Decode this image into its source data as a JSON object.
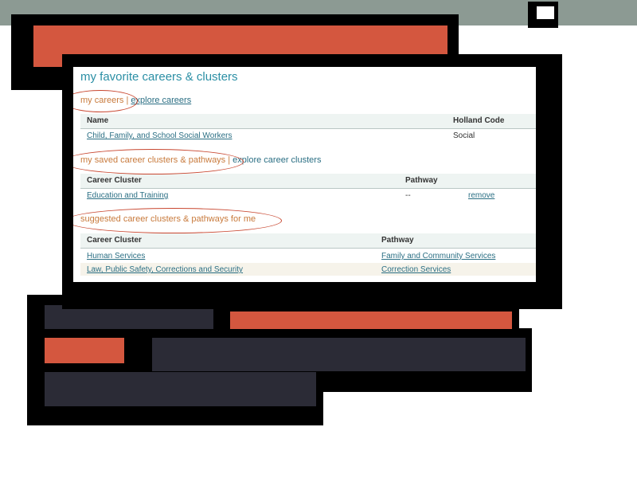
{
  "page": {
    "title": "my favorite careers & clusters"
  },
  "my_careers": {
    "heading": "my careers",
    "separator": "|",
    "explore_link": "explore careers",
    "columns": [
      "Name",
      "Holland Code"
    ],
    "rows": [
      {
        "name": "Child, Family, and School Social Workers",
        "holland_code": "Social"
      }
    ]
  },
  "saved_clusters": {
    "heading": "my saved career clusters & pathways",
    "separator": "|",
    "explore_link": "explore career clusters",
    "columns": [
      "Career Cluster",
      "Pathway"
    ],
    "rows": [
      {
        "cluster": "Education and Training",
        "pathway": "--",
        "action": "remove"
      }
    ]
  },
  "suggested_clusters": {
    "heading": "suggested career clusters & pathways for me",
    "columns": [
      "Career Cluster",
      "Pathway"
    ],
    "rows": [
      {
        "cluster": "Human Services",
        "pathway": "Family and Community Services"
      },
      {
        "cluster": "Law, Public Safety, Corrections and Security",
        "pathway": "Correction Services"
      }
    ]
  },
  "colors": {
    "accent_orange": "#d4573f",
    "title_teal": "#2b8fa5",
    "link_blue": "#2b6f84",
    "annotation_red": "#c8462f",
    "topbar_gray": "#8c9a93",
    "dark_block": "#2b2b36"
  }
}
